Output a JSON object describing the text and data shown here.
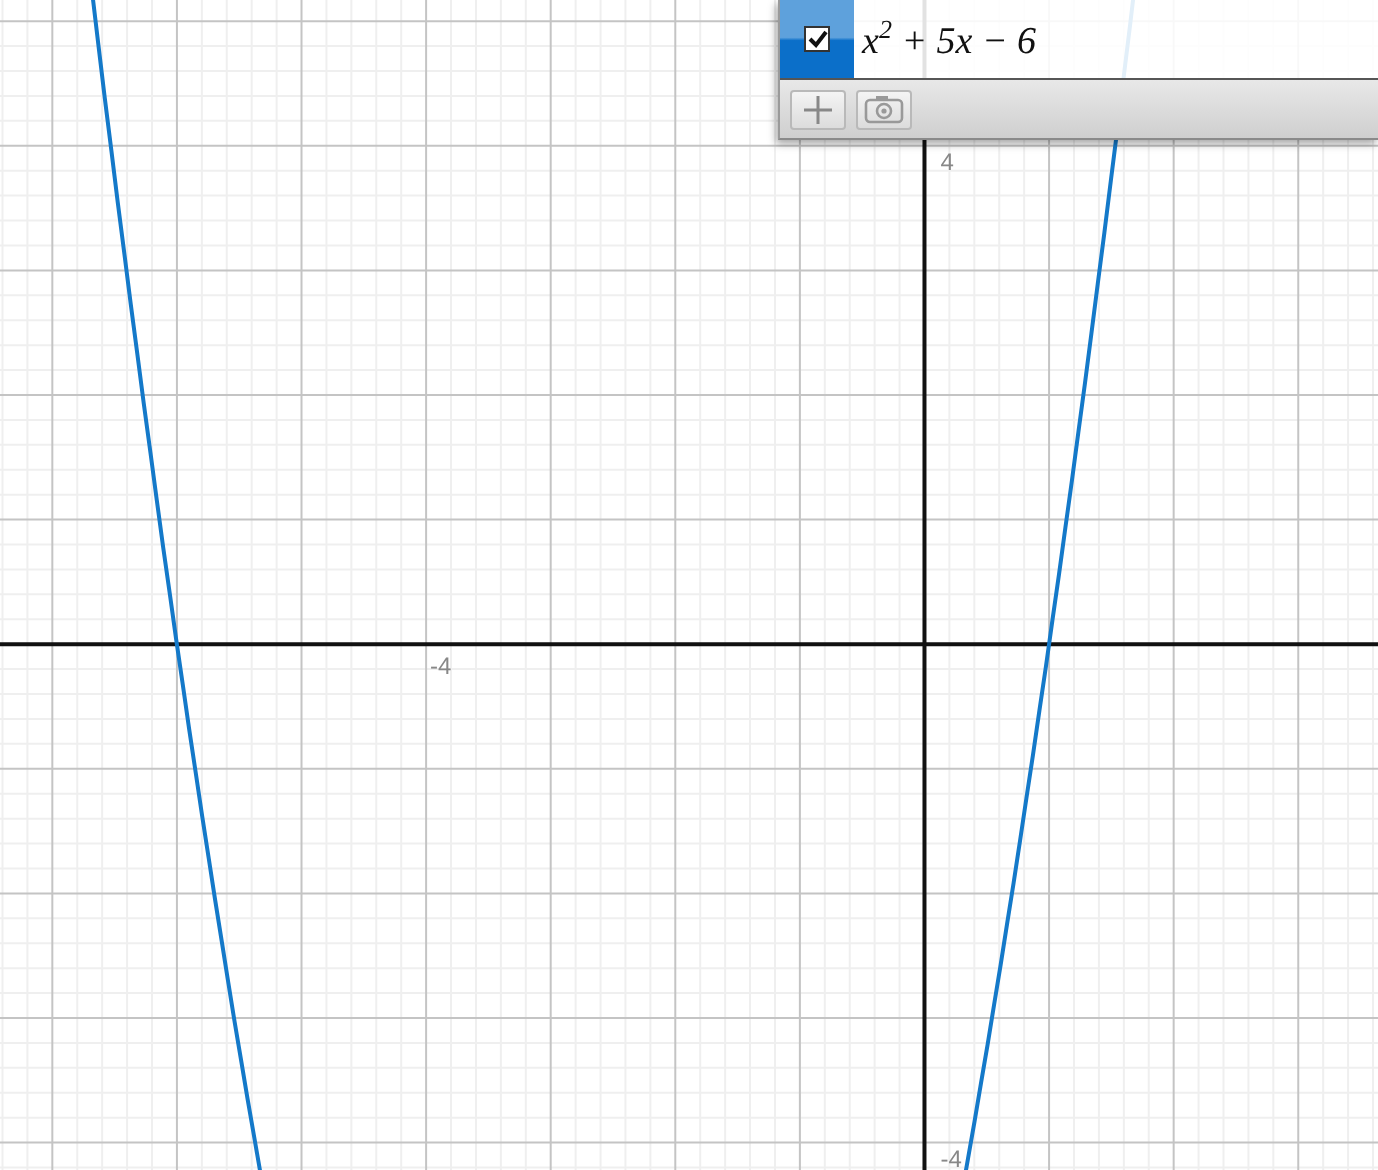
{
  "expression_panel": {
    "items": [
      {
        "expression": "x$^{2}$ + 5x − 6",
        "visible": true
      }
    ]
  },
  "graph": {
    "x_tick_labels": [
      "-4"
    ],
    "y_tick_labels": [
      "4",
      "-4"
    ]
  }
}
